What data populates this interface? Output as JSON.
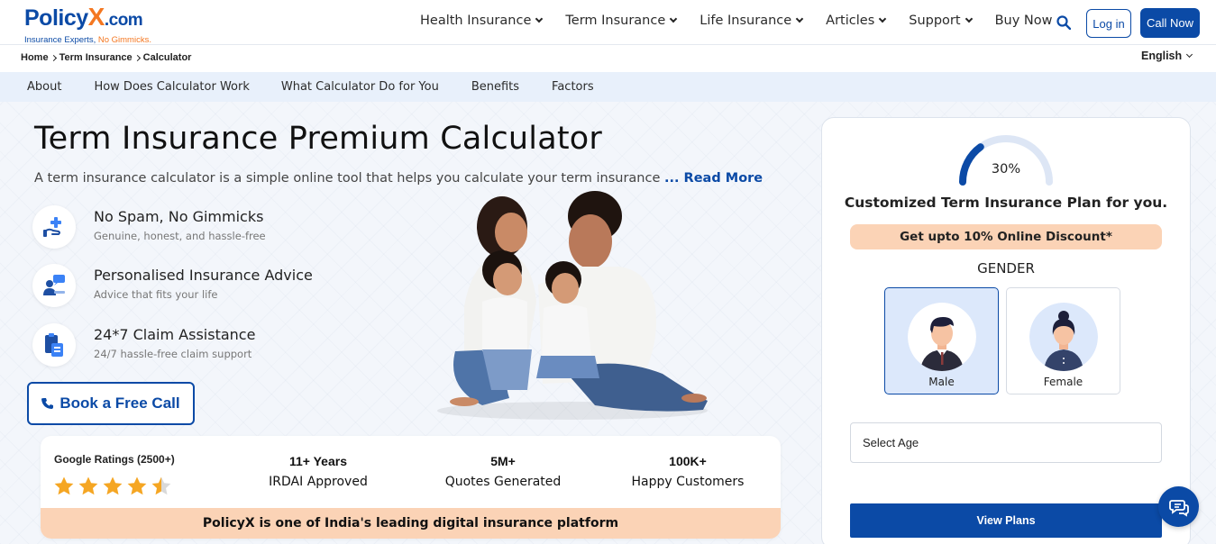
{
  "header": {
    "logo": {
      "main": "Policy",
      "x": "X",
      "com": ".com",
      "tag_prefix": "Insurance Experts, ",
      "tag_highlight": "No Gimmicks."
    },
    "nav": [
      {
        "label": "Health Insurance",
        "dropdown": true
      },
      {
        "label": "Term Insurance",
        "dropdown": true
      },
      {
        "label": "Life Insurance",
        "dropdown": true
      },
      {
        "label": "Articles",
        "dropdown": true
      },
      {
        "label": "Support",
        "dropdown": true
      },
      {
        "label": "Buy Now",
        "dropdown": false
      }
    ],
    "login_label": "Log in",
    "call_label": "Call Now"
  },
  "breadcrumb": [
    "Home",
    "Term Insurance",
    "Calculator"
  ],
  "language": "English",
  "subnav": [
    "About",
    "How Does Calculator Work",
    "What Calculator Do for You",
    "Benefits",
    "Factors"
  ],
  "hero": {
    "title": "Term Insurance Premium Calculator",
    "intro": "A term insurance calculator is a simple online tool that helps you calculate your term insurance",
    "read_more": "... Read More",
    "features": [
      {
        "icon": "hand-plus-icon",
        "title": "No Spam, No Gimmicks",
        "subtitle": "Genuine, honest, and hassle-free"
      },
      {
        "icon": "advisor-chat-icon",
        "title": "Personalised Insurance Advice",
        "subtitle": "Advice that fits your life"
      },
      {
        "icon": "clipboard-claim-icon",
        "title": "24*7 Claim Assistance",
        "subtitle": "24/7 hassle-free claim support"
      }
    ],
    "book_call_label": "Book a Free Call"
  },
  "stats": {
    "ratings_label": "Google Ratings (2500+)",
    "rating_value": 4.5,
    "items": [
      {
        "big": "11+ Years",
        "small": "IRDAI Approved"
      },
      {
        "big": "5M+",
        "small": "Quotes Generated"
      },
      {
        "big": "100K+",
        "small": "Happy Customers"
      }
    ],
    "banner": "PolicyX is one of India's leading digital insurance platform"
  },
  "form": {
    "progress_text": "30%",
    "progress_value": 0.3,
    "title": "Customized Term Insurance Plan for you.",
    "discount": "Get upto 10% Online Discount*",
    "gender_label": "GENDER",
    "gender_options": [
      {
        "label": "Male",
        "selected": true
      },
      {
        "label": "Female",
        "selected": false
      }
    ],
    "age_placeholder": "Select Age",
    "submit_label": "View Plans"
  },
  "colors": {
    "brand_blue": "#0b4aa6",
    "brand_orange": "#f47721",
    "peach": "#fbd3b6",
    "star": "#f5a623"
  }
}
